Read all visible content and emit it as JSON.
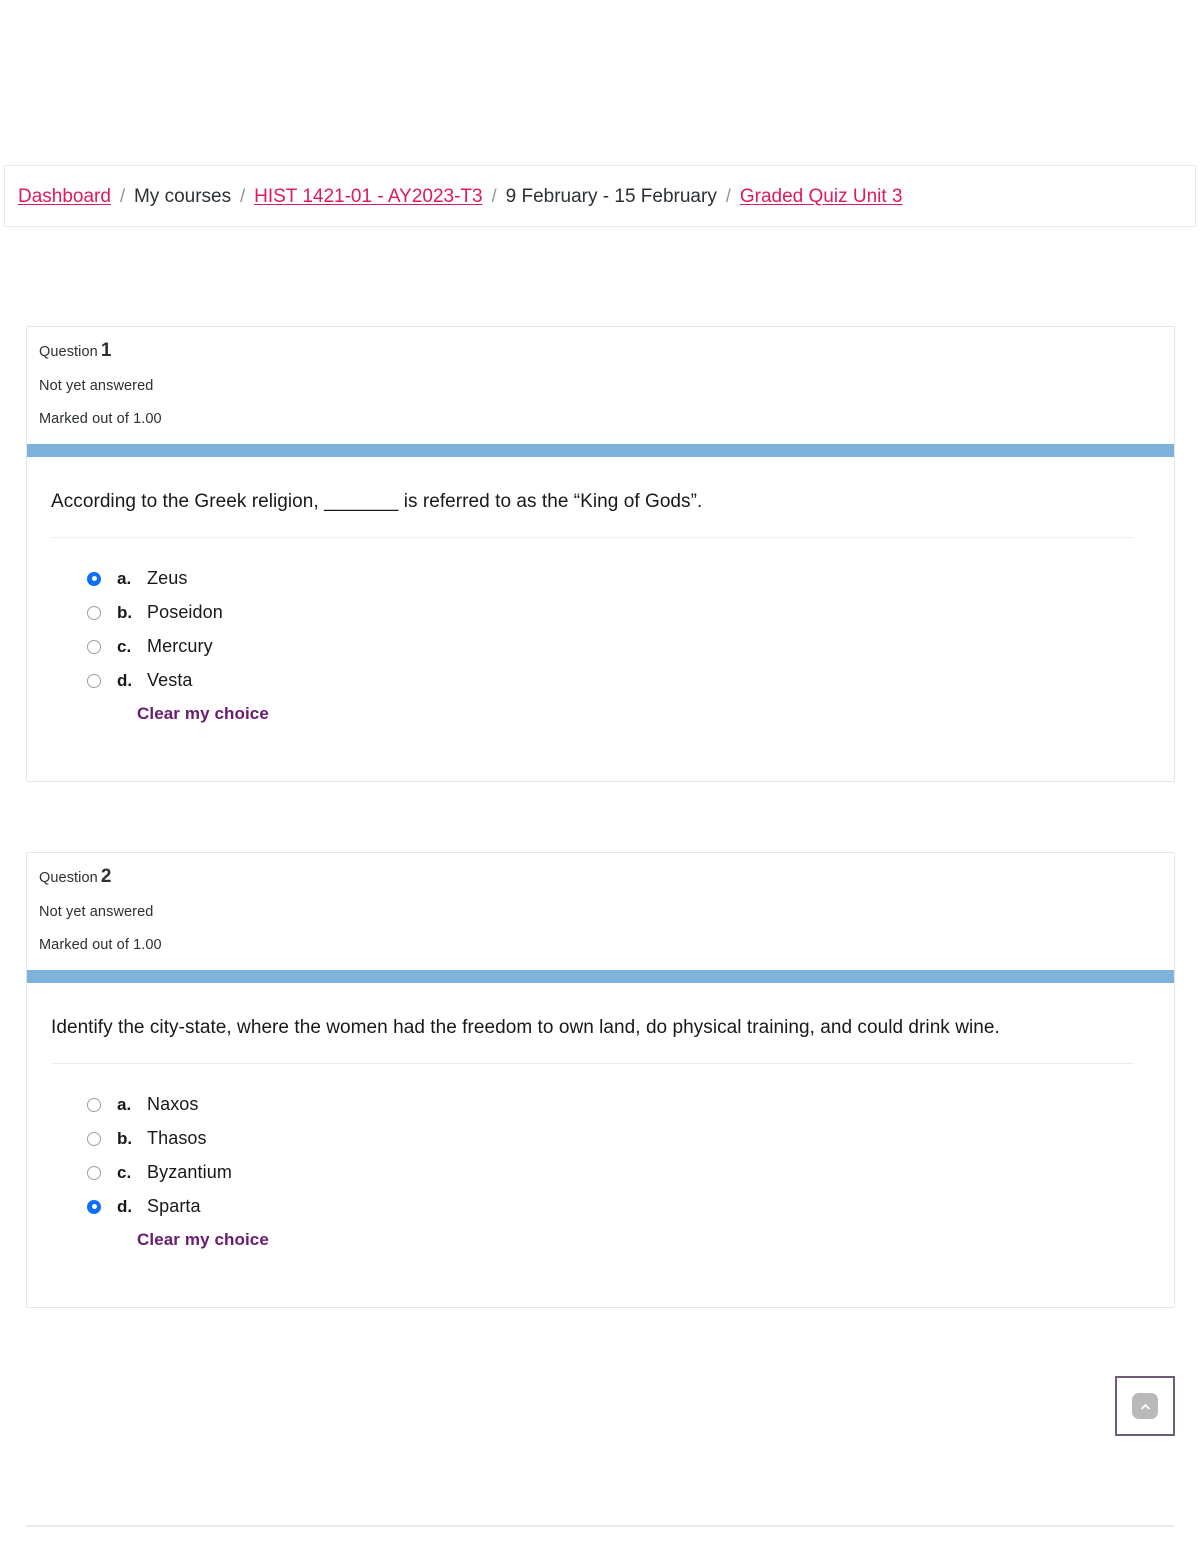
{
  "breadcrumb": {
    "items": [
      {
        "label": "Dashboard",
        "link": true
      },
      {
        "label": "My courses",
        "link": false
      },
      {
        "label": "HIST 1421-01 - AY2023-T3",
        "link": true
      },
      {
        "label": "9 February - 15 February",
        "link": false
      },
      {
        "label": "Graded Quiz Unit 3",
        "link": true
      }
    ],
    "separator": "/"
  },
  "theme": {
    "link_color": "#e0195f",
    "accent_bar_color": "#7db3da",
    "radio_selected_color": "#0d6efd",
    "clear_choice_color": "#6a1b73",
    "scroll_top_border_color": "#6d5d76"
  },
  "questions": [
    {
      "label": "Question",
      "number": "1",
      "state": "Not yet answered",
      "marks": "Marked out of 1.00",
      "text": "According to the Greek religion, _______ is referred to as the “King of Gods”.",
      "clear_label": "Clear my choice",
      "options": [
        {
          "letter": "a.",
          "text": "Zeus",
          "selected": true
        },
        {
          "letter": "b.",
          "text": "Poseidon",
          "selected": false
        },
        {
          "letter": "c.",
          "text": "Mercury",
          "selected": false
        },
        {
          "letter": "d.",
          "text": "Vesta",
          "selected": false
        }
      ]
    },
    {
      "label": "Question",
      "number": "2",
      "state": "Not yet answered",
      "marks": "Marked out of 1.00",
      "text": "Identify the city-state, where the women had the freedom to own land, do physical training, and could drink wine.",
      "clear_label": "Clear my choice",
      "options": [
        {
          "letter": "a.",
          "text": "Naxos",
          "selected": false
        },
        {
          "letter": "b.",
          "text": "Thasos",
          "selected": false
        },
        {
          "letter": "c.",
          "text": "Byzantium",
          "selected": false
        },
        {
          "letter": "d.",
          "text": "Sparta",
          "selected": true
        }
      ]
    }
  ],
  "scroll_top": {
    "icon": "chevron-up-icon"
  }
}
